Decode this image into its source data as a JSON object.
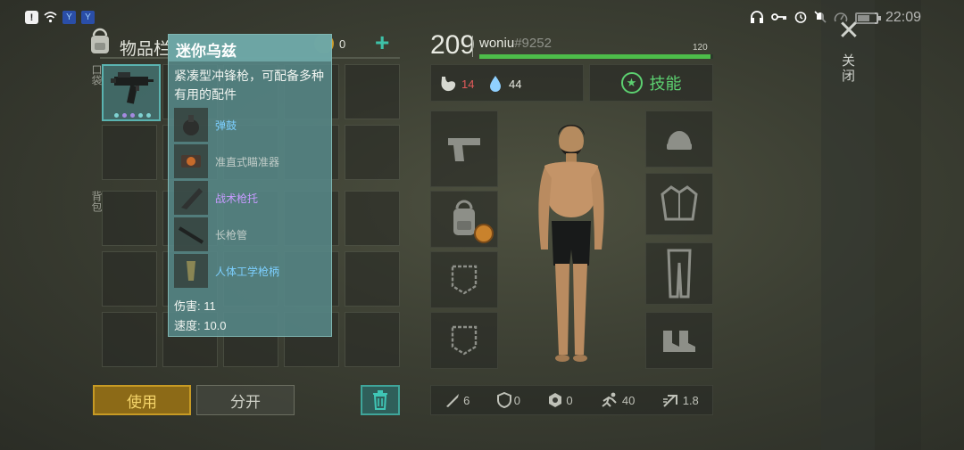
{
  "status_bar": {
    "time": "22:09"
  },
  "close": {
    "label": "关闭",
    "icon": "close-icon"
  },
  "inventory": {
    "title": "物品栏",
    "coins": "0",
    "pocket_label": "口袋",
    "backpack_label": "背包"
  },
  "tooltip": {
    "title": "迷你乌兹",
    "description": "紧凑型冲锋枪，可配备多种有用的配件",
    "attachments": [
      {
        "name": "弹鼓",
        "icon": "drum-magazine-icon"
      },
      {
        "name": "准直式瞄准器",
        "icon": "scope-icon"
      },
      {
        "name": "战术枪托",
        "icon": "stock-icon"
      },
      {
        "name": "长枪管",
        "icon": "barrel-icon"
      },
      {
        "name": "人体工学枪柄",
        "icon": "grip-icon"
      }
    ],
    "damage": "伤害: 11",
    "speed": "速度: 10.0"
  },
  "buttons": {
    "use": "使用",
    "split": "分开"
  },
  "character": {
    "level": "209",
    "username": "woniu",
    "user_tag": "#9252",
    "xp_max": "120",
    "xp_fraction": 0.99,
    "hunger": "14",
    "thirst": "44",
    "skill_label": "技能"
  },
  "bottom_stats": [
    {
      "icon": "knife-icon",
      "value": "6"
    },
    {
      "icon": "shield-icon",
      "value": "0"
    },
    {
      "icon": "armor-icon",
      "value": "0"
    },
    {
      "icon": "run-icon",
      "value": "40"
    },
    {
      "icon": "speed-icon",
      "value": "1.8"
    }
  ],
  "colors": {
    "xp_bar": "#4dbd4a",
    "hunger": "#e25a5a",
    "skill": "#5cd070",
    "use_button": "#c79a24"
  }
}
